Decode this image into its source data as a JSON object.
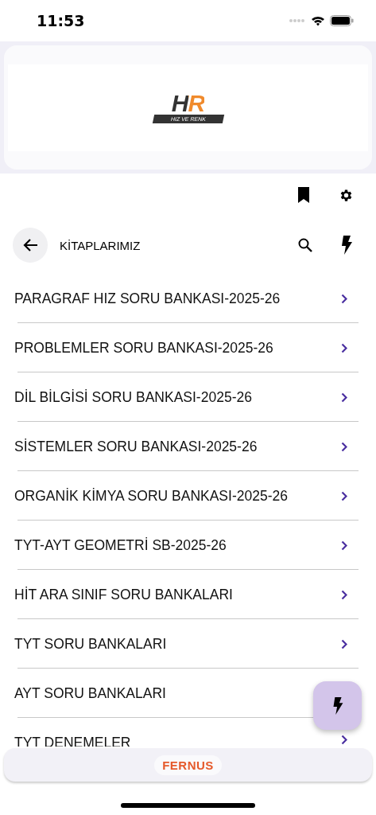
{
  "status_bar": {
    "time": "11:53"
  },
  "banner": {
    "logo_mark": "HR",
    "logo_caption": "HIZ VE RENK"
  },
  "header": {
    "title": "KİTAPLARIMIZ"
  },
  "books": [
    {
      "title": "PARAGRAF HIZ SORU BANKASI-2025-26"
    },
    {
      "title": "PROBLEMLER SORU BANKASI-2025-26"
    },
    {
      "title": "DİL BİLGİSİ SORU BANKASI-2025-26"
    },
    {
      "title": "SİSTEMLER SORU BANKASI-2025-26"
    },
    {
      "title": "ORGANİK KİMYA SORU BANKASI-2025-26"
    },
    {
      "title": "TYT-AYT GEOMETRİ SB-2025-26"
    },
    {
      "title": "HİT ARA SINIF SORU BANKALARI"
    },
    {
      "title": "TYT SORU BANKALARI"
    },
    {
      "title": "AYT SORU BANKALARI"
    },
    {
      "title": "TYT DENEMELER"
    }
  ],
  "footer": {
    "brand": "FERNUS"
  }
}
